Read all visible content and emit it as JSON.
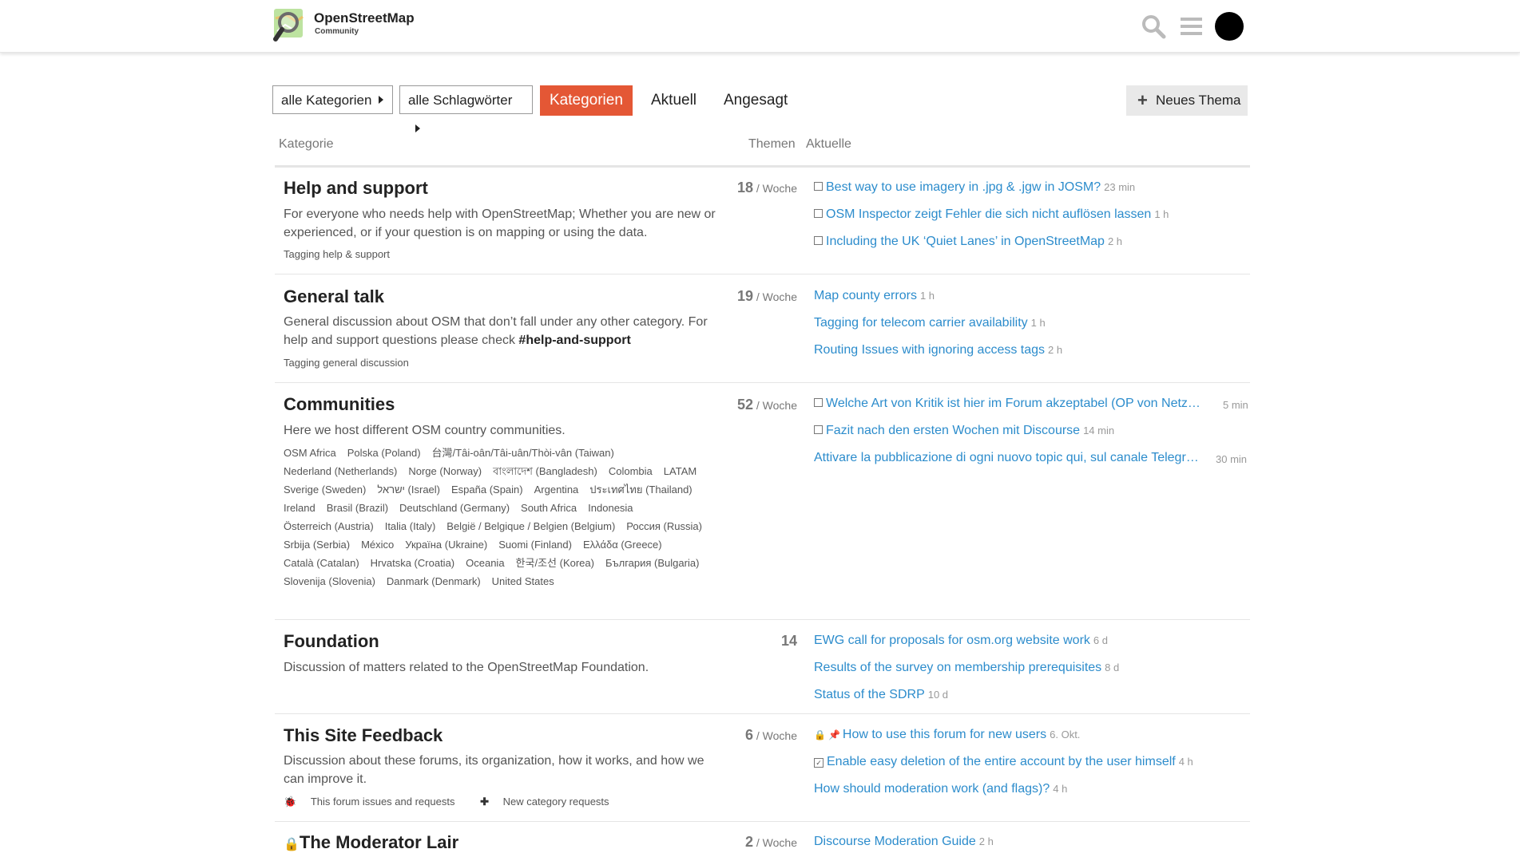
{
  "header": {
    "logo_title": "OpenStreetMap",
    "logo_subtitle": "Community",
    "icons": [
      "search-icon",
      "hamburger-menu-icon",
      "user-avatar"
    ]
  },
  "nav": {
    "categories_dropdown": "alle Kategorien",
    "tags_dropdown": "alle Schlagwörter",
    "tabs": [
      "Kategorien",
      "Aktuell",
      "Angesagt"
    ],
    "active_tab": "Kategorien",
    "new_topic": "Neues Thema"
  },
  "columns": {
    "category": "Kategorie",
    "topics": "Themen",
    "latest": "Aktuelle"
  },
  "categories": [
    {
      "title": "Help and support",
      "desc": "For everyone who needs help with OpenStreetMap; Whether you are new or experienced, or if your question is on mapping or using the data.",
      "subcats": [
        "Tagging help & support"
      ],
      "count": "18",
      "per": " / Woche",
      "topics": [
        {
          "title": "Best way to use imagery in .jpg & .jgw in JOSM?",
          "age": "23 min"
        },
        {
          "title": "OSM Inspector zeigt Fehler die sich nicht auflösen lassen",
          "age": "1 h"
        },
        {
          "title": "Including the UK ‘Quiet Lanes’ in OpenStreetMap",
          "age": "2 h"
        }
      ]
    },
    {
      "title": "General talk",
      "desc": "General discussion about OSM that don’t fall under any other category. For help and support questions please check ",
      "desc_bold": "#help-and-support",
      "subcats": [
        "Tagging general discussion"
      ],
      "count": "19",
      "per": " / Woche",
      "topics": [
        {
          "title": "Map county errors",
          "age": "1 h"
        },
        {
          "title": "Tagging for telecom carrier availability",
          "age": "1 h"
        },
        {
          "title": "Routing Issues with ignoring access tags",
          "age": "2 h"
        }
      ]
    },
    {
      "title": "Communities",
      "desc": "Here we host different OSM country communities.",
      "subcats": [
        "OSM Africa",
        "Polska (Poland)",
        "台灣/Tâi-oân/Tâi-uân/Thòi-vân (Taiwan)",
        "Nederland (Netherlands)",
        "Norge (Norway)",
        "বাংলাদেশ (Bangladesh)",
        "Colombia",
        "LATAM",
        "Sverige (Sweden)",
        "ישראל (Israel)",
        "España (Spain)",
        "Argentina",
        "ประเทศไทย (Thailand)",
        "Ireland",
        "Brasil (Brazil)",
        "Deutschland (Germany)",
        "South Africa",
        "Indonesia",
        "Österreich (Austria)",
        "Italia (Italy)",
        "België / Belgique / Belgien (Belgium)",
        "Россия (Russia)",
        "Srbija (Serbia)",
        "México",
        "Україна (Ukraine)",
        "Suomi (Finland)",
        "Ελλάδα (Greece)",
        "Català (Catalan)",
        "Hrvatska (Croatia)",
        "Oceania",
        "한국/조선 (Korea)",
        "България (Bulgaria)",
        "Slovenija (Slovenia)",
        "Danmark (Denmark)",
        "United States"
      ],
      "count": "52",
      "per": " / Woche",
      "topics": [
        {
          "title": "Welche Art von Kritik ist hier im Forum akzeptabel (OP von Netz…",
          "age": "5 min"
        },
        {
          "title": "Fazit nach den ersten Wochen mit Discourse",
          "age": "14 min"
        },
        {
          "title": "Attivare la pubblicazione di ogni nuovo topic qui, sul canale Telegr…",
          "age": "30 min"
        }
      ]
    },
    {
      "title": "Foundation",
      "desc": "Discussion of matters related to the OpenStreetMap Foundation.",
      "count": "14",
      "topics": [
        {
          "title": "EWG call for proposals for osm.org website work",
          "age": "6 d"
        },
        {
          "title": "Results of the survey on membership prerequisites",
          "age": "8 d"
        },
        {
          "title": "Status of the SDRP",
          "age": "10 d"
        }
      ]
    },
    {
      "title": "This Site Feedback",
      "desc": "Discussion about these forums, its organization, how it works, and how we can improve it.",
      "subcats": [
        "This forum issues and requests",
        "New category requests"
      ],
      "count": "6",
      "per": " / Woche",
      "topics": [
        {
          "title": "How to use this forum for new users",
          "age": "6. Okt."
        },
        {
          "title": "Enable easy deletion of the entire account by the user himself",
          "age": "4 h"
        },
        {
          "title": "How should moderation work (and flags)?",
          "age": "4 h"
        }
      ]
    },
    {
      "title": "The Moderator Lair",
      "count": "2",
      "per": " / Woche",
      "topics": [
        {
          "title": "Discourse Moderation Guide",
          "age": "2 h"
        }
      ]
    }
  ]
}
